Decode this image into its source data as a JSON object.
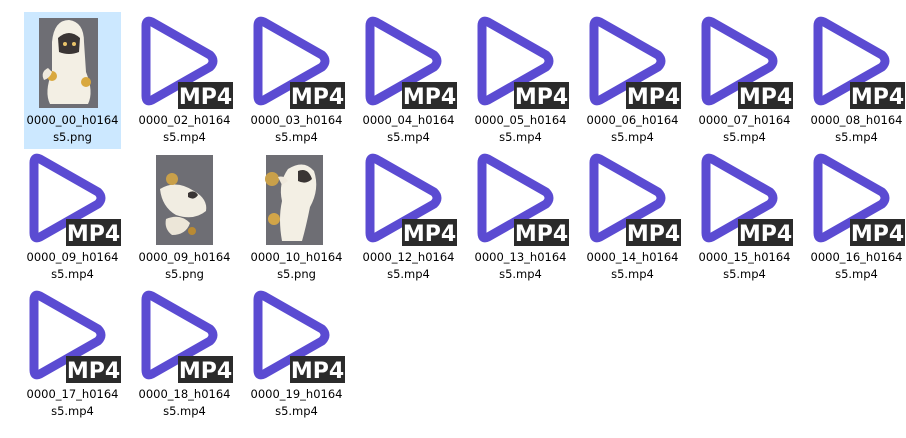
{
  "badge_text": "MP4",
  "colors": {
    "play_stroke": "#5b4bd2",
    "badge_bg": "#2b2b2b",
    "badge_text": "#ffffff",
    "selection": "#cce8ff",
    "png_bg": "#6e6e74"
  },
  "files": [
    {
      "line1": "0000_00_h0164",
      "line2": "s5.png",
      "kind": "png",
      "icon": "character-thumbnail-icon",
      "selected": true
    },
    {
      "line1": "0000_02_h0164",
      "line2": "s5.mp4",
      "kind": "mp4",
      "icon": "mp4-video-icon"
    },
    {
      "line1": "0000_03_h0164",
      "line2": "s5.mp4",
      "kind": "mp4",
      "icon": "mp4-video-icon"
    },
    {
      "line1": "0000_04_h0164",
      "line2": "s5.mp4",
      "kind": "mp4",
      "icon": "mp4-video-icon"
    },
    {
      "line1": "0000_05_h0164",
      "line2": "s5.mp4",
      "kind": "mp4",
      "icon": "mp4-video-icon"
    },
    {
      "line1": "0000_06_h0164",
      "line2": "s5.mp4",
      "kind": "mp4",
      "icon": "mp4-video-icon"
    },
    {
      "line1": "0000_07_h0164",
      "line2": "s5.mp4",
      "kind": "mp4",
      "icon": "mp4-video-icon"
    },
    {
      "line1": "0000_08_h0164",
      "line2": "s5.mp4",
      "kind": "mp4",
      "icon": "mp4-video-icon"
    },
    {
      "line1": "0000_09_h0164",
      "line2": "s5.mp4",
      "kind": "mp4",
      "icon": "mp4-video-icon"
    },
    {
      "line1": "0000_09_h0164",
      "line2": "s5.png",
      "kind": "png",
      "icon": "character-thumbnail-icon"
    },
    {
      "line1": "0000_10_h0164",
      "line2": "s5.png",
      "kind": "png",
      "icon": "character-thumbnail-icon"
    },
    {
      "line1": "0000_12_h0164",
      "line2": "s5.mp4",
      "kind": "mp4",
      "icon": "mp4-video-icon"
    },
    {
      "line1": "0000_13_h0164",
      "line2": "s5.mp4",
      "kind": "mp4",
      "icon": "mp4-video-icon"
    },
    {
      "line1": "0000_14_h0164",
      "line2": "s5.mp4",
      "kind": "mp4",
      "icon": "mp4-video-icon"
    },
    {
      "line1": "0000_15_h0164",
      "line2": "s5.mp4",
      "kind": "mp4",
      "icon": "mp4-video-icon"
    },
    {
      "line1": "0000_16_h0164",
      "line2": "s5.mp4",
      "kind": "mp4",
      "icon": "mp4-video-icon"
    },
    {
      "line1": "0000_17_h0164",
      "line2": "s5.mp4",
      "kind": "mp4",
      "icon": "mp4-video-icon"
    },
    {
      "line1": "0000_18_h0164",
      "line2": "s5.mp4",
      "kind": "mp4",
      "icon": "mp4-video-icon"
    },
    {
      "line1": "0000_19_h0164",
      "line2": "s5.mp4",
      "kind": "mp4",
      "icon": "mp4-video-icon"
    }
  ]
}
